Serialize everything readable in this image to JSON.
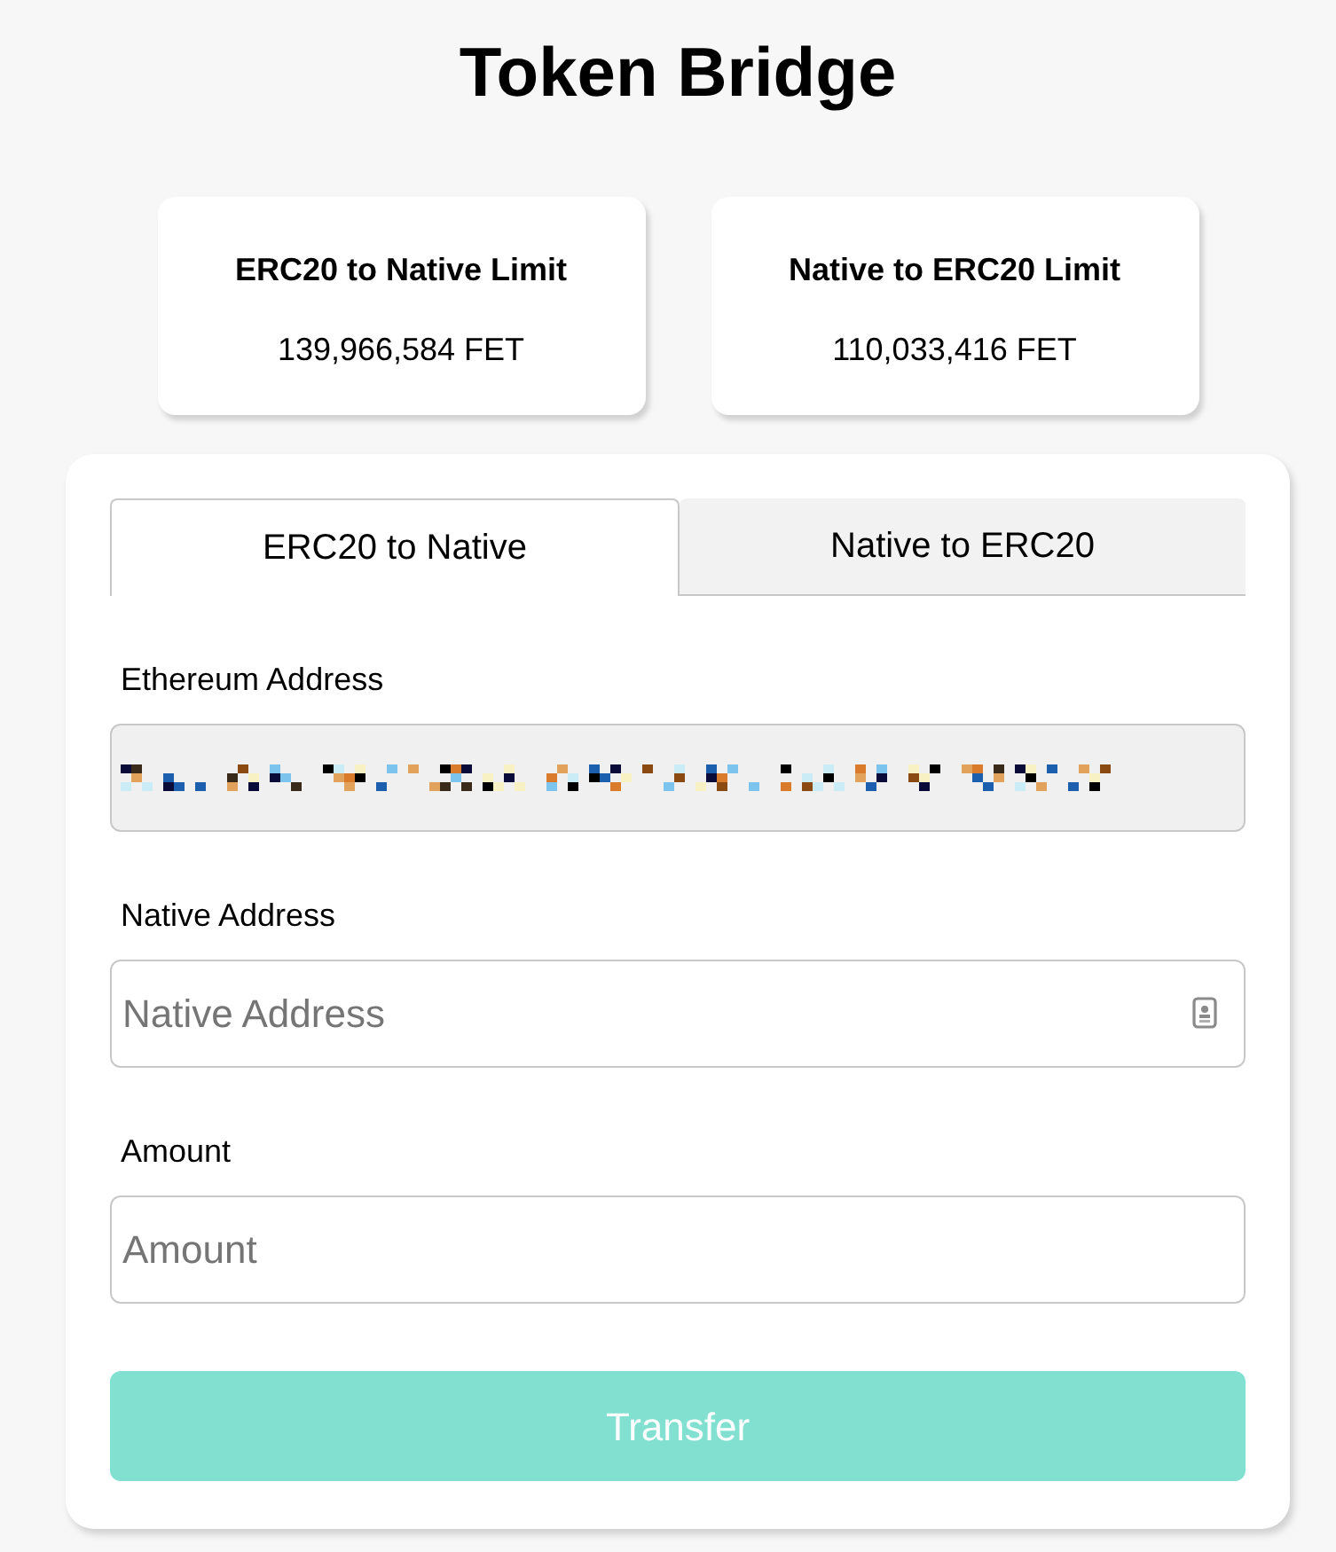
{
  "page": {
    "title": "Token Bridge"
  },
  "limits": [
    {
      "title": "ERC20 to Native Limit",
      "value": "139,966,584 FET"
    },
    {
      "title": "Native to ERC20 Limit",
      "value": "110,033,416 FET"
    }
  ],
  "tabs": [
    {
      "label": "ERC20 to Native",
      "selected": true
    },
    {
      "label": "Native to ERC20",
      "selected": false
    }
  ],
  "fields": [
    {
      "kind": "masked",
      "label": "Ethereum Address",
      "disabled": true
    },
    {
      "kind": "contact",
      "label": "Native Address",
      "placeholder": "Native Address",
      "disabled": false
    },
    {
      "kind": "text",
      "label": "Amount",
      "placeholder": "Amount",
      "disabled": false
    }
  ],
  "submit": {
    "label": "Transfer",
    "disabled": true
  }
}
